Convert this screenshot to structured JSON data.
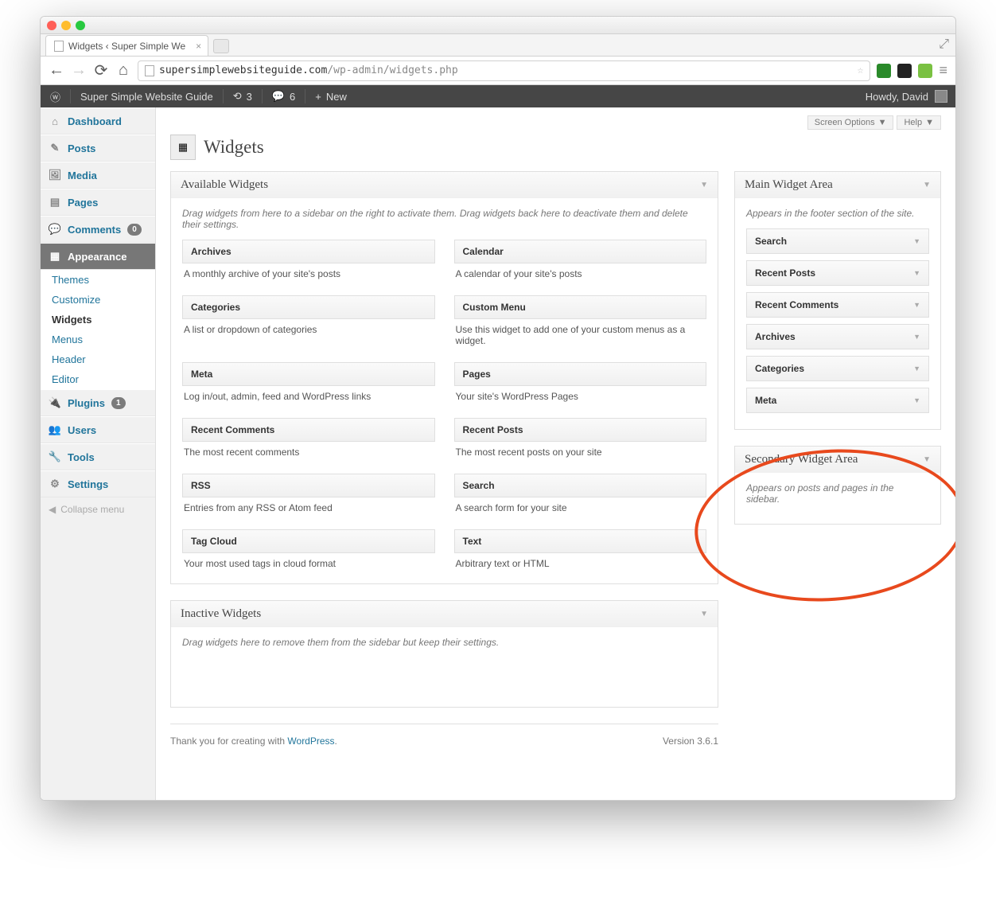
{
  "browser": {
    "tab_title": "Widgets ‹ Super Simple We",
    "url_host": "supersimplewebsiteguide.com",
    "url_path": "/wp-admin/widgets.php"
  },
  "adminbar": {
    "site_name": "Super Simple Website Guide",
    "refresh_count": "3",
    "comment_count": "6",
    "new_label": "New",
    "howdy": "Howdy, David"
  },
  "sidebar": {
    "dashboard": "Dashboard",
    "posts": "Posts",
    "media": "Media",
    "pages": "Pages",
    "comments": "Comments",
    "comments_badge": "0",
    "appearance": "Appearance",
    "submenu": {
      "themes": "Themes",
      "customize": "Customize",
      "widgets": "Widgets",
      "menus": "Menus",
      "header": "Header",
      "editor": "Editor"
    },
    "plugins": "Plugins",
    "plugins_badge": "1",
    "users": "Users",
    "tools": "Tools",
    "settings": "Settings",
    "collapse": "Collapse menu"
  },
  "topbuttons": {
    "screen_options": "Screen Options",
    "help": "Help"
  },
  "page": {
    "title": "Widgets"
  },
  "available": {
    "title": "Available Widgets",
    "instructions": "Drag widgets from here to a sidebar on the right to activate them. Drag widgets back here to deactivate them and delete their settings.",
    "widgets": [
      {
        "name": "Archives",
        "desc": "A monthly archive of your site's posts"
      },
      {
        "name": "Calendar",
        "desc": "A calendar of your site's posts"
      },
      {
        "name": "Categories",
        "desc": "A list or dropdown of categories"
      },
      {
        "name": "Custom Menu",
        "desc": "Use this widget to add one of your custom menus as a widget."
      },
      {
        "name": "Meta",
        "desc": "Log in/out, admin, feed and WordPress links"
      },
      {
        "name": "Pages",
        "desc": "Your site's WordPress Pages"
      },
      {
        "name": "Recent Comments",
        "desc": "The most recent comments"
      },
      {
        "name": "Recent Posts",
        "desc": "The most recent posts on your site"
      },
      {
        "name": "RSS",
        "desc": "Entries from any RSS or Atom feed"
      },
      {
        "name": "Search",
        "desc": "A search form for your site"
      },
      {
        "name": "Tag Cloud",
        "desc": "Your most used tags in cloud format"
      },
      {
        "name": "Text",
        "desc": "Arbitrary text or HTML"
      }
    ]
  },
  "main_area": {
    "title": "Main Widget Area",
    "desc": "Appears in the footer section of the site.",
    "widgets": [
      "Search",
      "Recent Posts",
      "Recent Comments",
      "Archives",
      "Categories",
      "Meta"
    ]
  },
  "secondary_area": {
    "title": "Secondary Widget Area",
    "desc": "Appears on posts and pages in the sidebar."
  },
  "inactive": {
    "title": "Inactive Widgets",
    "desc": "Drag widgets here to remove them from the sidebar but keep their settings."
  },
  "footer": {
    "thanks_pre": "Thank you for creating with ",
    "thanks_link": "WordPress",
    "version": "Version 3.6.1"
  }
}
